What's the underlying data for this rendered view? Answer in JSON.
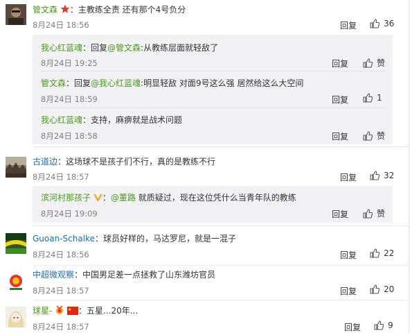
{
  "comments": [
    {
      "user": "管文森",
      "text": "：主教练全责 还有那个4号负分",
      "time": "8月24日 18:56",
      "reply": "回复",
      "likes": "36",
      "avatar": "avatar-dark-man",
      "badge": "red-star-icon",
      "replies": [
        {
          "user": "我心红蓝魂",
          "text": "：回复",
          "mention": "@管文森",
          "text2": ":从教练层面就轻敌了",
          "time": "8月24日 19:25",
          "reply": "回复",
          "likes": "赞"
        },
        {
          "user": "管文森",
          "text": "：回复",
          "mention": "@我心红蓝魂",
          "text2": ":明显轻敌 对面9号这么强 居然给这么大空间",
          "time": "8月24日 18:59",
          "reply": "回复",
          "likes": "1"
        },
        {
          "user": "我心红蓝魂",
          "text": "：支持，麻痹就是战术问题",
          "time": "8月24日 18:58",
          "reply": "回复",
          "likes": "赞"
        }
      ]
    },
    {
      "user": "古道边",
      "text": "：这场球不是孩子们不行，真的是教练不行",
      "time": "8月24日 18:57",
      "reply": "回复",
      "likes": "32",
      "avatar": "avatar-landscape",
      "replies": [
        {
          "user": "滨河村那孩子",
          "badge": "V",
          "text": "：",
          "mention": "@董路",
          "text2": " 就质疑过，现在这位凭什么当青年队的教练",
          "time": "8月24日 19:09",
          "reply": "回复",
          "likes": "赞"
        }
      ]
    },
    {
      "user": "Guoan-Schalke",
      "text": "：球员好样的，马达罗尼，就是一混子",
      "time": "8月24日 18:56",
      "reply": "回复",
      "likes": "22",
      "avatar": "avatar-stadium"
    },
    {
      "user": "中超微观察",
      "text": "：中国男足差一点拯救了山东潍坊官员",
      "time": "8月24日 18:57",
      "reply": "回复",
      "likes": "20",
      "avatar": "avatar-csl-logo"
    },
    {
      "user": "球星-",
      "text": "：五星...20年...",
      "time": "8月24日 18:57",
      "reply": "回复",
      "likes": "9",
      "avatar": "avatar-anime-girl",
      "badge": "medal-and-china-flag-icon"
    }
  ],
  "colors": {
    "username_orange": "#eb7350",
    "username_green": "#4a9a1d",
    "username_blue": "#1a6fb0",
    "subbox_bg": "#f2f2f5",
    "time_gray": "#808080"
  },
  "icons": {
    "like": "thumbs-up-icon",
    "verified": "yellow-v-verified-icon"
  }
}
